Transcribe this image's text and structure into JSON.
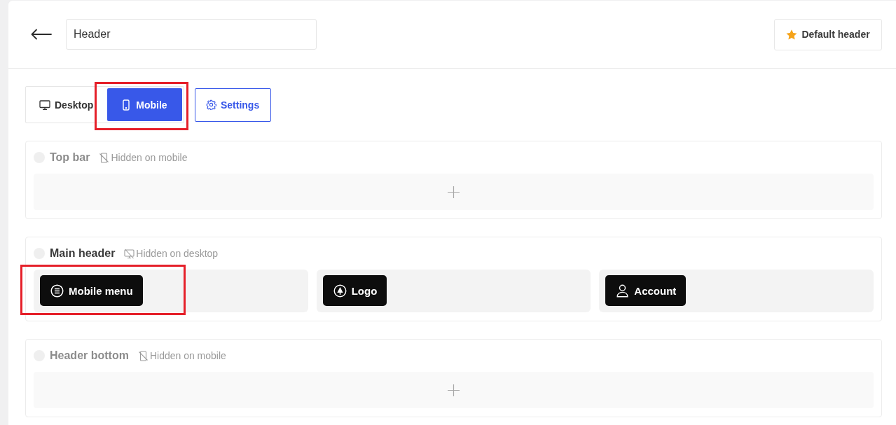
{
  "title_field": {
    "value": "Header"
  },
  "default_button": {
    "label": "Default header"
  },
  "tabs": [
    {
      "label": "Desktop",
      "kind": "desktop",
      "selected": false,
      "highlighted": false
    },
    {
      "label": "Mobile",
      "kind": "mobile",
      "selected": true,
      "highlighted": true
    }
  ],
  "settings_button": {
    "label": "Settings"
  },
  "sections": [
    {
      "title": "Top bar",
      "dimmed": true,
      "visibility": {
        "kind": "mobile-off",
        "text": "Hidden on mobile"
      },
      "zones": [
        {
          "kind": "add"
        }
      ]
    },
    {
      "title": "Main header",
      "dimmed": false,
      "visibility": {
        "kind": "desktop-off",
        "text": "Hidden on desktop"
      },
      "zones": [
        {
          "kind": "slot",
          "item": {
            "kind": "menu",
            "label": "Mobile menu",
            "highlighted": true
          }
        },
        {
          "kind": "slot",
          "item": {
            "kind": "logo",
            "label": "Logo",
            "highlighted": false
          }
        },
        {
          "kind": "slot",
          "item": {
            "kind": "account",
            "label": "Account",
            "highlighted": false
          }
        }
      ]
    },
    {
      "title": "Header bottom",
      "dimmed": true,
      "visibility": {
        "kind": "mobile-off",
        "text": "Hidden on mobile"
      },
      "zones": [
        {
          "kind": "add"
        }
      ]
    }
  ]
}
